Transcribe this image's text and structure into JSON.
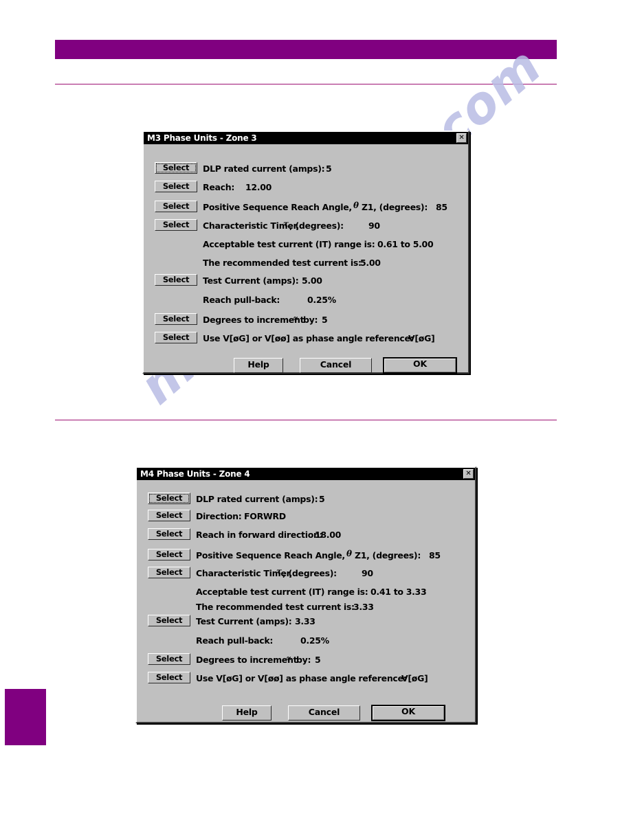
{
  "page": {
    "header_bar_color": "#800080",
    "rule_color": "#9c1072",
    "corner_tab_color": "#800080",
    "watermark_text": "manualshive.com",
    "watermark_color": "#b9bde4"
  },
  "dialogs": [
    {
      "id": "m3",
      "title": "M3 Phase Units - Zone 3",
      "close_icon": "close-icon",
      "close_glyph": "✕",
      "rows": [
        {
          "button": "Select",
          "focused": true,
          "label": "DLP rated current (amps):",
          "value": "5"
        },
        {
          "button": "Select",
          "focused": false,
          "label": "Reach:",
          "value": "12.00"
        },
        {
          "button": "Select",
          "focused": false,
          "label": "Positive Sequence Reach Angle,",
          "symbol": "θ",
          "label2": "Z1, (degrees):",
          "value": "85"
        },
        {
          "button": "Select",
          "focused": false,
          "label": "Characteristic Timer,",
          "symbol": "τ",
          "label2": ", (degrees):",
          "value": "90"
        },
        {
          "button": null,
          "focused": false,
          "label": "Acceptable test current (IT) range is:",
          "value": "0.61 to 5.00"
        },
        {
          "button": null,
          "focused": false,
          "label": "The recommended test current is:",
          "value": "5.00"
        },
        {
          "button": "Select",
          "focused": false,
          "label": "Test Current (amps):",
          "value": "5.00"
        },
        {
          "button": null,
          "focused": false,
          "label": "Reach pull-back:",
          "value": "0.25%"
        },
        {
          "button": "Select",
          "focused": false,
          "label": "Degrees to increment",
          "symbol": "∝",
          "label2": "by:",
          "value": "5"
        },
        {
          "button": "Select",
          "focused": false,
          "label": "Use V[øG] or V[øø] as phase angle reference:",
          "value": "V[øG]"
        }
      ],
      "actions": {
        "help": "Help",
        "cancel": "Cancel",
        "ok": "OK"
      }
    },
    {
      "id": "m4",
      "title": "M4 Phase Units - Zone 4",
      "close_icon": "close-icon",
      "close_glyph": "✕",
      "rows": [
        {
          "button": "Select",
          "focused": true,
          "label": "DLP rated current (amps):",
          "value": "5"
        },
        {
          "button": "Select",
          "focused": false,
          "label": "Direction:",
          "value": "FORWRD"
        },
        {
          "button": "Select",
          "focused": false,
          "label": "Reach in forward direction:",
          "value": "18.00"
        },
        {
          "button": "Select",
          "focused": false,
          "label": "Positive Sequence Reach Angle,",
          "symbol": "θ",
          "label2": "Z1, (degrees):",
          "value": "85"
        },
        {
          "button": "Select",
          "focused": false,
          "label": "Characteristic Timer,",
          "symbol": "τ",
          "label2": ", (degrees):",
          "value": "90"
        },
        {
          "button": null,
          "focused": false,
          "label": "Acceptable test current (IT) range is:",
          "value": "0.41 to 3.33"
        },
        {
          "button": null,
          "focused": false,
          "label": "The recommended test current is:",
          "value": "3.33"
        },
        {
          "button": "Select",
          "focused": false,
          "label": "Test Current (amps):",
          "value": "3.33"
        },
        {
          "button": null,
          "focused": false,
          "label": "Reach pull-back:",
          "value": "0.25%"
        },
        {
          "button": "Select",
          "focused": false,
          "label": "Degrees to increment",
          "symbol": "∝",
          "label2": "by:",
          "value": "5"
        },
        {
          "button": "Select",
          "focused": false,
          "label": "Use V[øG] or V[øø] as phase angle reference:",
          "value": "V[øG]"
        }
      ],
      "actions": {
        "help": "Help",
        "cancel": "Cancel",
        "ok": "OK"
      }
    }
  ]
}
